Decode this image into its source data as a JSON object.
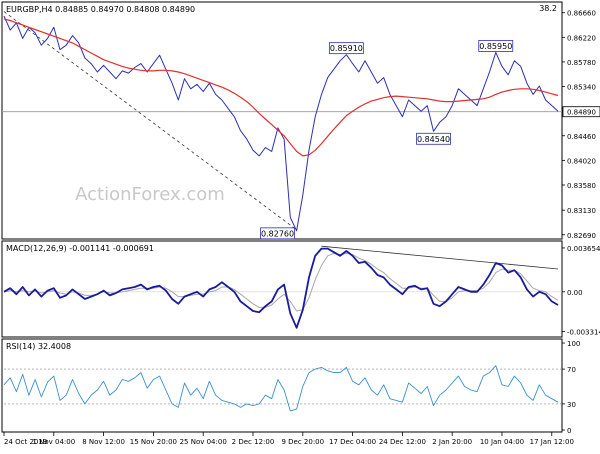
{
  "chart_data": [
    {
      "type": "line",
      "panel": "price",
      "title": "EURGBP,H4  0.84885 0.84970 0.84808 0.84890",
      "corner_value": "38.2",
      "watermark": "ActionForex.com",
      "ylim": [
        0.8265,
        0.8678
      ],
      "y_ticks": [
        "0.86660",
        "0.86220",
        "0.85780",
        "0.85340",
        "0.84890",
        "0.84460",
        "0.84020",
        "0.83580",
        "0.83130",
        "0.82690"
      ],
      "current_price": "0.84890",
      "colors": {
        "price": "#2b2fb5",
        "ma": "#e03030",
        "trendline": "#333333",
        "label_border": "#2b2fb5"
      },
      "series": [
        {
          "values": [
            0.866,
            0.8635,
            0.8648,
            0.862,
            0.864,
            0.863,
            0.8608,
            0.862,
            0.864,
            0.86,
            0.8608,
            0.8625,
            0.8612,
            0.8585,
            0.8575,
            0.856,
            0.8572,
            0.856,
            0.8548,
            0.8562,
            0.8558,
            0.8568,
            0.8575,
            0.856,
            0.8575,
            0.859,
            0.8565,
            0.854,
            0.851,
            0.8548,
            0.853,
            0.8538,
            0.8525,
            0.854,
            0.852,
            0.851,
            0.8495,
            0.848,
            0.8455,
            0.844,
            0.842,
            0.841,
            0.8425,
            0.8418,
            0.846,
            0.844,
            0.83,
            0.8276,
            0.834,
            0.842,
            0.848,
            0.852,
            0.855,
            0.8565,
            0.858,
            0.8591,
            0.8575,
            0.856,
            0.858,
            0.856,
            0.854,
            0.855,
            0.852,
            0.85,
            0.848,
            0.851,
            0.85,
            0.849,
            0.85,
            0.8454,
            0.847,
            0.848,
            0.85,
            0.853,
            0.852,
            0.851,
            0.85,
            0.853,
            0.856,
            0.8595,
            0.857,
            0.8555,
            0.858,
            0.857,
            0.854,
            0.852,
            0.8535,
            0.851,
            0.85,
            0.849
          ]
        },
        {
          "values": [
            0.8655,
            0.8652,
            0.8648,
            0.8644,
            0.864,
            0.8636,
            0.8632,
            0.8628,
            0.8624,
            0.862,
            0.8616,
            0.8612,
            0.8606,
            0.86,
            0.8594,
            0.8588,
            0.8582,
            0.8578,
            0.8574,
            0.857,
            0.8567,
            0.8565,
            0.8563,
            0.8562,
            0.8562,
            0.8563,
            0.8563,
            0.8562,
            0.856,
            0.8557,
            0.8553,
            0.8549,
            0.8545,
            0.8541,
            0.8537,
            0.8533,
            0.8528,
            0.8522,
            0.8515,
            0.8507,
            0.8497,
            0.8486,
            0.8476,
            0.8466,
            0.8456,
            0.8446,
            0.8432,
            0.8418,
            0.841,
            0.8412,
            0.842,
            0.8432,
            0.8445,
            0.8458,
            0.847,
            0.8482,
            0.849,
            0.8497,
            0.8503,
            0.8508,
            0.8511,
            0.8514,
            0.8516,
            0.8517,
            0.8516,
            0.8515,
            0.8514,
            0.8513,
            0.8512,
            0.851,
            0.8508,
            0.8507,
            0.8507,
            0.8508,
            0.8509,
            0.851,
            0.8511,
            0.8512,
            0.8515,
            0.852,
            0.8524,
            0.8527,
            0.8529,
            0.853,
            0.853,
            0.8529,
            0.8527,
            0.8524,
            0.8521,
            0.8518
          ]
        }
      ],
      "trendline": {
        "from_index": 0,
        "from_value": 0.8668,
        "to_index": 47,
        "to_value": 0.8278
      },
      "annotations": [
        {
          "label": "0.85910",
          "index": 55,
          "value": 0.8591
        },
        {
          "label": "0.85950",
          "index": 79,
          "value": 0.8595
        },
        {
          "label": "0.84540",
          "index": 69,
          "value": 0.8454
        },
        {
          "label": "0.82760",
          "index": 47,
          "value": 0.8276
        }
      ]
    },
    {
      "type": "line",
      "panel": "macd",
      "title": "MACD(12,26,9) -0.001141 -0.000691",
      "ylim": [
        -0.0036,
        0.0039
      ],
      "y_ticks": [
        "0.003654",
        "0.00",
        "-0.003314"
      ],
      "colors": {
        "macd": "#1a1a9c",
        "signal": "#a8a8a8",
        "trendline": "#333333"
      },
      "series": [
        {
          "values": [
            0.0,
            0.0003,
            -0.0002,
            0.0004,
            -0.0003,
            0.0002,
            -0.0004,
            0.0001,
            0.0003,
            -0.0005,
            -0.0003,
            0.0002,
            -0.0002,
            -0.0006,
            -0.0004,
            -0.0002,
            0.0001,
            -0.0003,
            -0.0001,
            0.0002,
            0.0003,
            0.0004,
            0.0006,
            0.0002,
            0.0004,
            0.0005,
            0.0001,
            -0.0006,
            -0.001,
            -0.0004,
            -0.0002,
            0.0,
            -0.0004,
            0.0002,
            0.0004,
            0.0008,
            0.0004,
            0.0,
            -0.0008,
            -0.0012,
            -0.0016,
            -0.0017,
            -0.0012,
            -0.0008,
            0.0002,
            0.0006,
            -0.0018,
            -0.003,
            -0.0015,
            0.0012,
            0.003,
            0.0036,
            0.0036,
            0.0033,
            0.003,
            0.0034,
            0.003,
            0.0024,
            0.0025,
            0.002,
            0.0014,
            0.0012,
            0.0006,
            0.0002,
            -0.0002,
            0.0004,
            0.0005,
            0.0002,
            0.0003,
            -0.001,
            -0.0012,
            -0.0008,
            -0.0002,
            0.0004,
            0.0002,
            0.0,
            0.0,
            0.0006,
            0.0014,
            0.0024,
            0.0022,
            0.0016,
            0.0018,
            0.0012,
            0.0002,
            -0.0004,
            0.0,
            -0.0002,
            -0.0008,
            -0.0011
          ]
        },
        {
          "values": [
            0.0,
            0.0001,
            0.0,
            0.0001,
            0.0,
            0.0001,
            -0.0001,
            0.0,
            0.0001,
            -0.0001,
            -0.0002,
            0.0,
            -0.0001,
            -0.0003,
            -0.0003,
            -0.0002,
            0.0,
            -0.0001,
            -0.0001,
            0.0,
            0.0001,
            0.0002,
            0.0003,
            0.0003,
            0.0003,
            0.0004,
            0.0003,
            0.0,
            -0.0004,
            -0.0004,
            -0.0003,
            -0.0002,
            -0.0002,
            0.0,
            0.0001,
            0.0004,
            0.0004,
            0.0002,
            -0.0002,
            -0.0006,
            -0.001,
            -0.0013,
            -0.0013,
            -0.0011,
            -0.0006,
            -0.0002,
            -0.0008,
            -0.0016,
            -0.0015,
            -0.0005,
            0.001,
            0.0022,
            0.003,
            0.0032,
            0.0031,
            0.0032,
            0.0031,
            0.0028,
            0.0026,
            0.0023,
            0.0019,
            0.0016,
            0.0011,
            0.0007,
            0.0003,
            0.0003,
            0.0004,
            0.0003,
            0.0003,
            -0.0003,
            -0.0008,
            -0.0008,
            -0.0005,
            0.0,
            0.0001,
            0.0001,
            0.0001,
            0.0003,
            0.0008,
            0.0016,
            0.0019,
            0.0018,
            0.0018,
            0.0015,
            0.0009,
            0.0003,
            0.0001,
            0.0,
            -0.0004,
            -0.0007
          ]
        }
      ],
      "trendline": {
        "from_index": 51,
        "from_value": 0.0038,
        "to_index": 89,
        "to_value": 0.0019
      }
    },
    {
      "type": "line",
      "panel": "rsi",
      "title": "RSI(14) 32.4008",
      "ylim": [
        0,
        100
      ],
      "y_ticks": [
        "100",
        "70",
        "30",
        "0"
      ],
      "levels": [
        70,
        30
      ],
      "colors": {
        "rsi": "#3a8fd8",
        "level": "#888888"
      },
      "series": [
        {
          "values": [
            52,
            60,
            44,
            64,
            40,
            58,
            38,
            55,
            62,
            34,
            40,
            58,
            42,
            30,
            40,
            46,
            56,
            40,
            46,
            58,
            56,
            60,
            66,
            48,
            58,
            62,
            46,
            30,
            26,
            54,
            40,
            48,
            36,
            56,
            40,
            34,
            32,
            30,
            26,
            30,
            28,
            30,
            40,
            36,
            58,
            46,
            22,
            24,
            50,
            66,
            70,
            72,
            68,
            66,
            66,
            72,
            56,
            52,
            60,
            46,
            40,
            52,
            36,
            34,
            32,
            54,
            48,
            42,
            50,
            28,
            40,
            46,
            54,
            62,
            50,
            46,
            44,
            62,
            66,
            74,
            52,
            50,
            62,
            54,
            40,
            34,
            52,
            40,
            36,
            32
          ]
        }
      ]
    },
    {
      "type": "axis",
      "panel": "time",
      "x_labels": [
        "24 Oct 2019",
        "1 Nov 04:00",
        "8 Nov 12:00",
        "15 Nov 20:00",
        "25 Nov 04:00",
        "2 Dec 12:00",
        "9 Dec 20:00",
        "17 Dec 04:00",
        "24 Dec 12:00",
        "2 Jan 20:00",
        "10 Jan 04:00",
        "17 Jan 12:00"
      ],
      "x_label_index": [
        0,
        8,
        16,
        24,
        32,
        40,
        48,
        56,
        64,
        72,
        80,
        88
      ]
    }
  ]
}
